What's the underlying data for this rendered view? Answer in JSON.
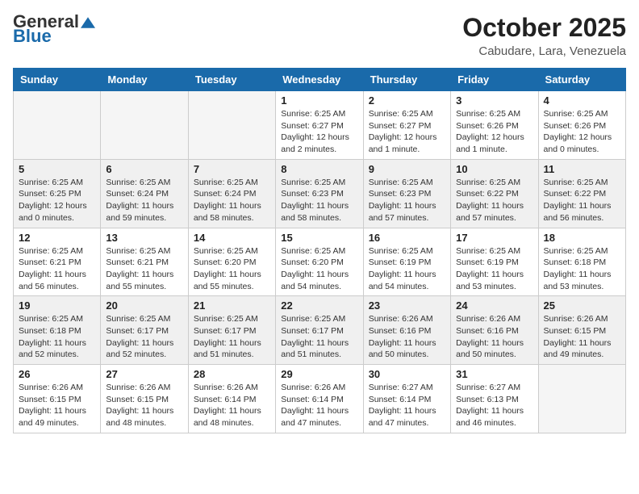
{
  "header": {
    "logo_general": "General",
    "logo_blue": "Blue",
    "month_title": "October 2025",
    "location": "Cabudare, Lara, Venezuela"
  },
  "days_of_week": [
    "Sunday",
    "Monday",
    "Tuesday",
    "Wednesday",
    "Thursday",
    "Friday",
    "Saturday"
  ],
  "weeks": [
    [
      {
        "day": "",
        "info": ""
      },
      {
        "day": "",
        "info": ""
      },
      {
        "day": "",
        "info": ""
      },
      {
        "day": "1",
        "info": "Sunrise: 6:25 AM\nSunset: 6:27 PM\nDaylight: 12 hours\nand 2 minutes."
      },
      {
        "day": "2",
        "info": "Sunrise: 6:25 AM\nSunset: 6:27 PM\nDaylight: 12 hours\nand 1 minute."
      },
      {
        "day": "3",
        "info": "Sunrise: 6:25 AM\nSunset: 6:26 PM\nDaylight: 12 hours\nand 1 minute."
      },
      {
        "day": "4",
        "info": "Sunrise: 6:25 AM\nSunset: 6:26 PM\nDaylight: 12 hours\nand 0 minutes."
      }
    ],
    [
      {
        "day": "5",
        "info": "Sunrise: 6:25 AM\nSunset: 6:25 PM\nDaylight: 12 hours\nand 0 minutes."
      },
      {
        "day": "6",
        "info": "Sunrise: 6:25 AM\nSunset: 6:24 PM\nDaylight: 11 hours\nand 59 minutes."
      },
      {
        "day": "7",
        "info": "Sunrise: 6:25 AM\nSunset: 6:24 PM\nDaylight: 11 hours\nand 58 minutes."
      },
      {
        "day": "8",
        "info": "Sunrise: 6:25 AM\nSunset: 6:23 PM\nDaylight: 11 hours\nand 58 minutes."
      },
      {
        "day": "9",
        "info": "Sunrise: 6:25 AM\nSunset: 6:23 PM\nDaylight: 11 hours\nand 57 minutes."
      },
      {
        "day": "10",
        "info": "Sunrise: 6:25 AM\nSunset: 6:22 PM\nDaylight: 11 hours\nand 57 minutes."
      },
      {
        "day": "11",
        "info": "Sunrise: 6:25 AM\nSunset: 6:22 PM\nDaylight: 11 hours\nand 56 minutes."
      }
    ],
    [
      {
        "day": "12",
        "info": "Sunrise: 6:25 AM\nSunset: 6:21 PM\nDaylight: 11 hours\nand 56 minutes."
      },
      {
        "day": "13",
        "info": "Sunrise: 6:25 AM\nSunset: 6:21 PM\nDaylight: 11 hours\nand 55 minutes."
      },
      {
        "day": "14",
        "info": "Sunrise: 6:25 AM\nSunset: 6:20 PM\nDaylight: 11 hours\nand 55 minutes."
      },
      {
        "day": "15",
        "info": "Sunrise: 6:25 AM\nSunset: 6:20 PM\nDaylight: 11 hours\nand 54 minutes."
      },
      {
        "day": "16",
        "info": "Sunrise: 6:25 AM\nSunset: 6:19 PM\nDaylight: 11 hours\nand 54 minutes."
      },
      {
        "day": "17",
        "info": "Sunrise: 6:25 AM\nSunset: 6:19 PM\nDaylight: 11 hours\nand 53 minutes."
      },
      {
        "day": "18",
        "info": "Sunrise: 6:25 AM\nSunset: 6:18 PM\nDaylight: 11 hours\nand 53 minutes."
      }
    ],
    [
      {
        "day": "19",
        "info": "Sunrise: 6:25 AM\nSunset: 6:18 PM\nDaylight: 11 hours\nand 52 minutes."
      },
      {
        "day": "20",
        "info": "Sunrise: 6:25 AM\nSunset: 6:17 PM\nDaylight: 11 hours\nand 52 minutes."
      },
      {
        "day": "21",
        "info": "Sunrise: 6:25 AM\nSunset: 6:17 PM\nDaylight: 11 hours\nand 51 minutes."
      },
      {
        "day": "22",
        "info": "Sunrise: 6:25 AM\nSunset: 6:17 PM\nDaylight: 11 hours\nand 51 minutes."
      },
      {
        "day": "23",
        "info": "Sunrise: 6:26 AM\nSunset: 6:16 PM\nDaylight: 11 hours\nand 50 minutes."
      },
      {
        "day": "24",
        "info": "Sunrise: 6:26 AM\nSunset: 6:16 PM\nDaylight: 11 hours\nand 50 minutes."
      },
      {
        "day": "25",
        "info": "Sunrise: 6:26 AM\nSunset: 6:15 PM\nDaylight: 11 hours\nand 49 minutes."
      }
    ],
    [
      {
        "day": "26",
        "info": "Sunrise: 6:26 AM\nSunset: 6:15 PM\nDaylight: 11 hours\nand 49 minutes."
      },
      {
        "day": "27",
        "info": "Sunrise: 6:26 AM\nSunset: 6:15 PM\nDaylight: 11 hours\nand 48 minutes."
      },
      {
        "day": "28",
        "info": "Sunrise: 6:26 AM\nSunset: 6:14 PM\nDaylight: 11 hours\nand 48 minutes."
      },
      {
        "day": "29",
        "info": "Sunrise: 6:26 AM\nSunset: 6:14 PM\nDaylight: 11 hours\nand 47 minutes."
      },
      {
        "day": "30",
        "info": "Sunrise: 6:27 AM\nSunset: 6:14 PM\nDaylight: 11 hours\nand 47 minutes."
      },
      {
        "day": "31",
        "info": "Sunrise: 6:27 AM\nSunset: 6:13 PM\nDaylight: 11 hours\nand 46 minutes."
      },
      {
        "day": "",
        "info": ""
      }
    ]
  ]
}
